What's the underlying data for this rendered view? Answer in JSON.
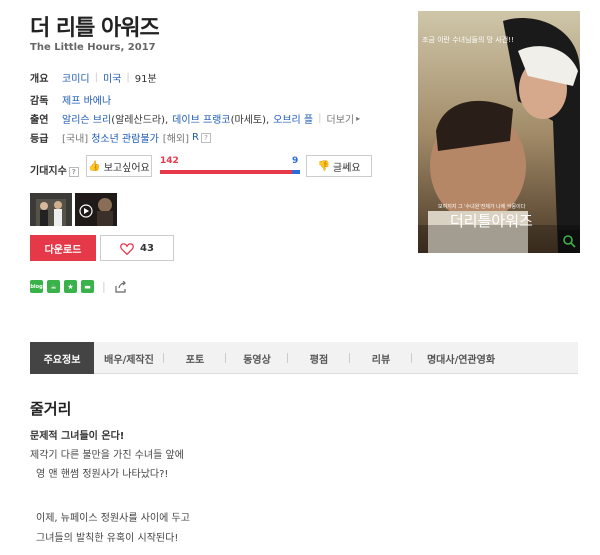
{
  "movie": {
    "title": "더 리틀 아워즈",
    "subtitle": "The Little Hours, 2017"
  },
  "info": {
    "overview_label": "개요",
    "genre": "코미디",
    "country": "미국",
    "runtime": "91분",
    "director_label": "감독",
    "director": "제프 바에나",
    "cast_label": "출연",
    "cast_1": "알리슨 브리",
    "cast_1_role": "(알레산드라),",
    "cast_2": "데이브 프랭코",
    "cast_2_role": "(마세토),",
    "cast_3": "오브리 플",
    "more_label": "더보기",
    "rating_label": "등급",
    "rating_domestic_prefix": "[국내]",
    "rating_domestic": "청소년 관람불가",
    "rating_overseas_prefix": "[해외]",
    "rating_overseas": "R"
  },
  "expectation": {
    "label": "기대지수",
    "want_label": "보고싶어요",
    "notwant_label": "글쎄요",
    "want_count": "142",
    "notwant_count": "9",
    "want_ratio": 0.94
  },
  "actions": {
    "download_label": "다운로드",
    "like_count": "43"
  },
  "tabs": [
    {
      "label": "주요정보",
      "active": true
    },
    {
      "label": "배우/제작진"
    },
    {
      "label": "포토"
    },
    {
      "label": "동영상"
    },
    {
      "label": "평점"
    },
    {
      "label": "리뷰"
    },
    {
      "label": "명대사/연관영화"
    }
  ],
  "synopsis": {
    "heading": "줄거리",
    "line_1": "문제적 그녀들이 온다!",
    "line_2": "제각기 다른 불만을 가진 수녀들 앞에",
    "line_3": "영 앤 핸썸 정원사가 나타났다?!",
    "line_4": "이제, 뉴페이스 정원사를 사이에 두고",
    "line_5": "그녀들의 발칙한 유혹이 시작된다!"
  },
  "poster": {
    "tagline": "조금 이란 수녀님들의 망 사건!!",
    "title_text": "더리틀아워즈",
    "quote": "보여지지 그 '수녀원'전체가 나에 악몽이다"
  },
  "share": {
    "icon_1": "blog",
    "icon_2": "cafe",
    "icon_3": "star",
    "icon_4": "line"
  },
  "colors": {
    "accent_red": "#e5394a",
    "accent_blue": "#2a6cd4",
    "link": "#1d5ab5",
    "share_green": "#3ab24a"
  }
}
